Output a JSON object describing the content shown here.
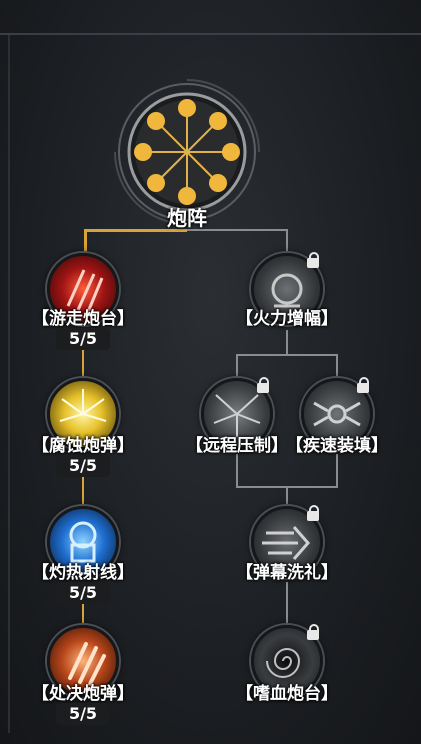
{
  "root": {
    "label": "炮阵"
  },
  "left_branch": [
    {
      "label": "【游走炮台】",
      "count": "5/5"
    },
    {
      "label": "【腐蚀炮弹】",
      "count": "5/5"
    },
    {
      "label": "【灼热射线】",
      "count": "5/5"
    },
    {
      "label": "【处决炮弹】",
      "count": "5/5"
    }
  ],
  "right_branch": {
    "top": {
      "label": "【火力增幅】"
    },
    "mid_left": {
      "label": "【远程压制】"
    },
    "mid_right": {
      "label": "【疾速装填】"
    },
    "lower": {
      "label": "【弹幕洗礼】"
    },
    "bottom": {
      "label": "【嗜血炮台】"
    }
  },
  "colors": {
    "unlocked_line": "#d9a23a",
    "locked_line": "#8a8d90"
  }
}
